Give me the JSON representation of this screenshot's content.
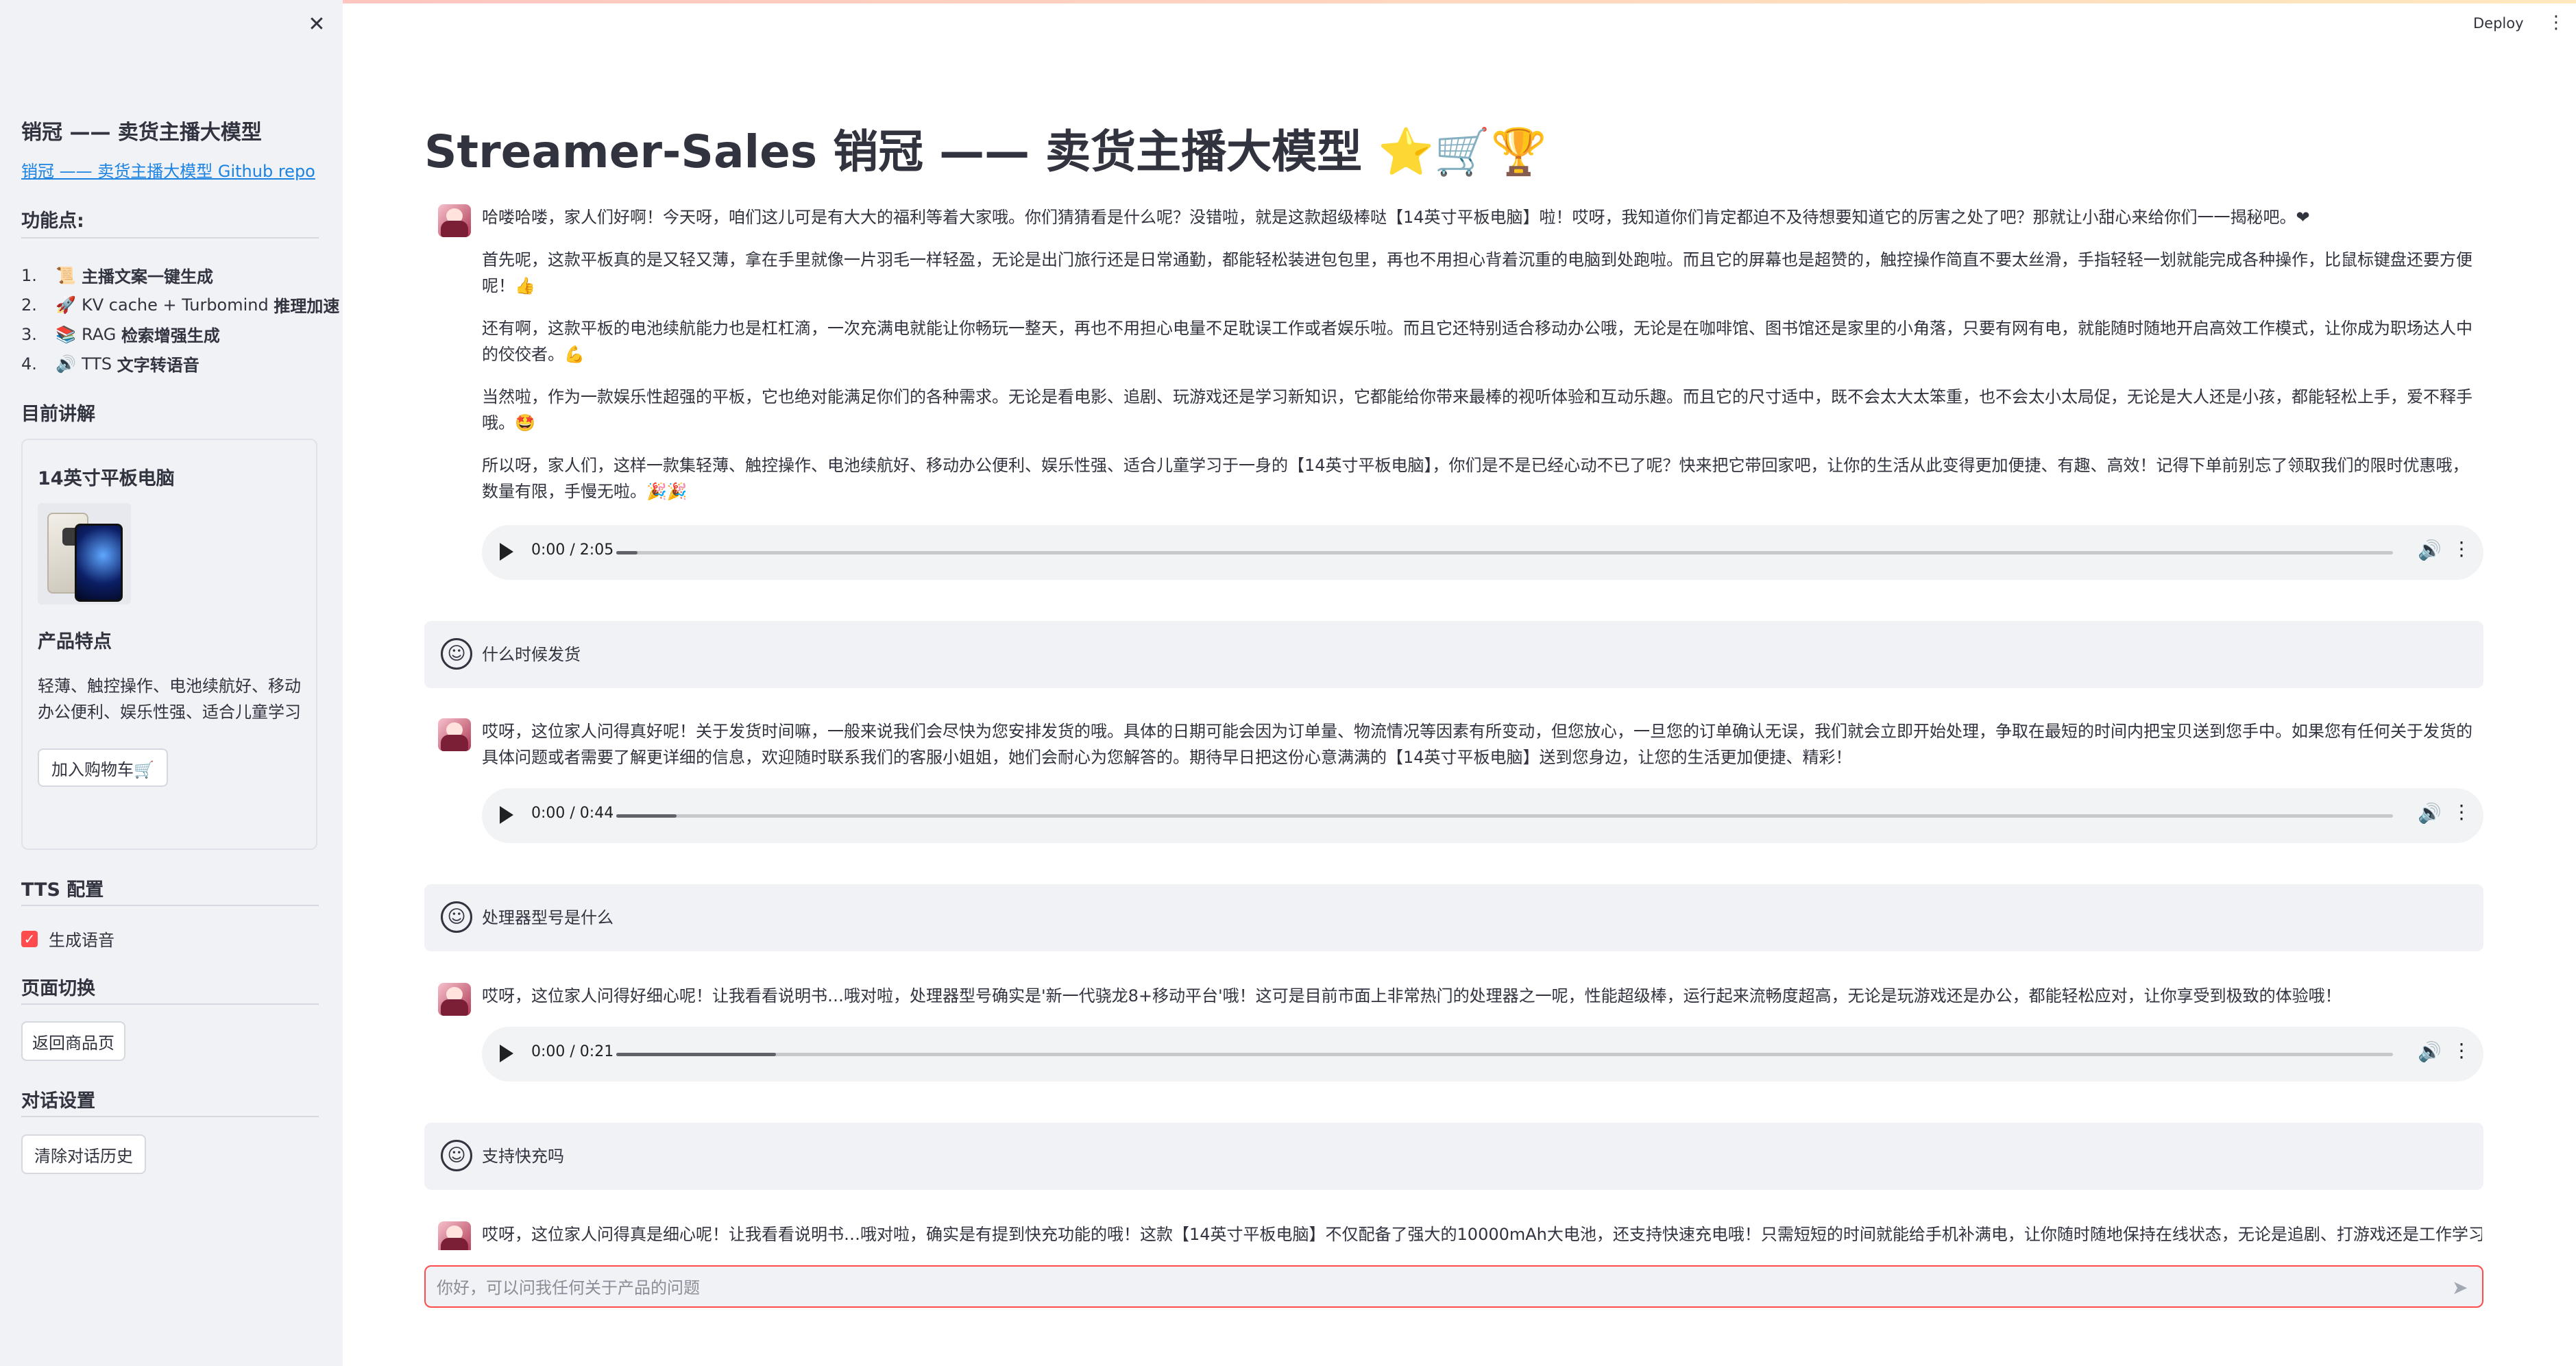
{
  "sidebar": {
    "close_glyph": "✕",
    "title": "销冠 —— 卖货主播大模型",
    "repo_link": "销冠 —— 卖货主播大模型 Github repo",
    "features_heading": "功能点:",
    "features": [
      {
        "num": "1.",
        "icon": "📜",
        "prefix": "",
        "bold": "主播文案一键生成"
      },
      {
        "num": "2.",
        "icon": "🚀",
        "prefix": "KV cache + Turbomind ",
        "bold": "推理加速"
      },
      {
        "num": "3.",
        "icon": "📚",
        "prefix": "RAG ",
        "bold": "检索增强生成"
      },
      {
        "num": "4.",
        "icon": "🔊",
        "prefix": "TTS ",
        "bold": "文字转语音"
      }
    ],
    "current_heading": "目前讲解",
    "product": {
      "name": "14英寸平板电脑",
      "features_heading": "产品特点",
      "features_text": "轻薄、触控操作、电池续航好、移动办公便利、娱乐性强、适合儿童学习",
      "add_cart": "加入购物车🛒"
    },
    "tts_heading": "TTS 配置",
    "tts_checkbox_label": "生成语音",
    "page_switch_heading": "页面切换",
    "back_button": "返回商品页",
    "dialog_heading": "对话设置",
    "clear_button": "清除对话历史"
  },
  "header": {
    "deploy": "Deploy",
    "menu_glyph": "⋮"
  },
  "main": {
    "title_text": "Streamer-Sales 销冠 —— 卖货主播大模型",
    "title_emojis": [
      "⭐",
      "🛒",
      "🏆"
    ],
    "messages": [
      {
        "role": "assistant",
        "paragraphs": [
          "哈喽哈喽，家人们好啊！今天呀，咱们这儿可是有大大的福利等着大家哦。你们猜猜看是什么呢？没错啦，就是这款超级棒哒【14英寸平板电脑】啦！哎呀，我知道你们肯定都迫不及待想要知道它的厉害之处了吧？那就让小甜心来给你们一一揭秘吧。❤",
          "首先呢，这款平板真的是又轻又薄，拿在手里就像一片羽毛一样轻盈，无论是出门旅行还是日常通勤，都能轻松装进包包里，再也不用担心背着沉重的电脑到处跑啦。而且它的屏幕也是超赞的，触控操作简直不要太丝滑，手指轻轻一划就能完成各种操作，比鼠标键盘还要方便呢！👍",
          "还有啊，这款平板的电池续航能力也是杠杠滴，一次充满电就能让你畅玩一整天，再也不用担心电量不足耽误工作或者娱乐啦。而且它还特别适合移动办公哦，无论是在咖啡馆、图书馆还是家里的小角落，只要有网有电，就能随时随地开启高效工作模式，让你成为职场达人中的佼佼者。💪",
          "当然啦，作为一款娱乐性超强的平板，它也绝对能满足你们的各种需求。无论是看电影、追剧、玩游戏还是学习新知识，它都能给你带来最棒的视听体验和互动乐趣。而且它的尺寸适中，既不会太大太笨重，也不会太小太局促，无论是大人还是小孩，都能轻松上手，爱不释手哦。🤩",
          "所以呀，家人们，这样一款集轻薄、触控操作、电池续航好、移动办公便利、娱乐性强、适合儿童学习于一身的【14英寸平板电脑】，你们是不是已经心动不已了呢？快来把它带回家吧，让你的生活从此变得更加便捷、有趣、高效！记得下单前别忘了领取我们的限时优惠哦，数量有限，手慢无啦。🎉🎉"
        ],
        "audio": {
          "time": "0:00 / 2:05",
          "progress": 0.012
        }
      },
      {
        "role": "user",
        "text": "什么时候发货"
      },
      {
        "role": "assistant",
        "paragraphs": [
          "哎呀，这位家人问得真好呢！关于发货时间嘛，一般来说我们会尽快为您安排发货的哦。具体的日期可能会因为订单量、物流情况等因素有所变动，但您放心，一旦您的订单确认无误，我们就会立即开始处理，争取在最短的时间内把宝贝送到您手中。如果您有任何关于发货的具体问题或者需要了解更详细的信息，欢迎随时联系我们的客服小姐姐，她们会耐心为您解答的。期待早日把这份心意满满的【14英寸平板电脑】送到您身边，让您的生活更加便捷、精彩！"
        ],
        "audio": {
          "time": "0:00 / 0:44",
          "progress": 0.034
        }
      },
      {
        "role": "user",
        "text": "处理器型号是什么"
      },
      {
        "role": "assistant",
        "paragraphs": [
          "哎呀，这位家人问得好细心呢！让我看看说明书…哦对啦，处理器型号确实是'新一代骁龙8+移动平台'哦！这可是目前市面上非常热门的处理器之一呢，性能超级棒，运行起来流畅度超高，无论是玩游戏还是办公，都能轻松应对，让你享受到极致的体验哦！"
        ],
        "audio": {
          "time": "0:00 / 0:21",
          "progress": 0.09
        }
      },
      {
        "role": "user",
        "text": "支持快充吗"
      },
      {
        "role": "assistant",
        "paragraphs": [
          "哎呀，这位家人问得真是细心呢！让我看看说明书…哦对啦，确实是有提到快充功能的哦！这款【14英寸平板电脑】不仅配备了强大的10000mAh大电池，还支持快速充电哦！只需短短的时间就能给手机补满电，让你随时随地保持在线状态，无论是追剧、打游戏还是工作学习，"
        ]
      }
    ]
  },
  "chat_input": {
    "placeholder": "你好，可以问我任何关于产品的问题"
  }
}
